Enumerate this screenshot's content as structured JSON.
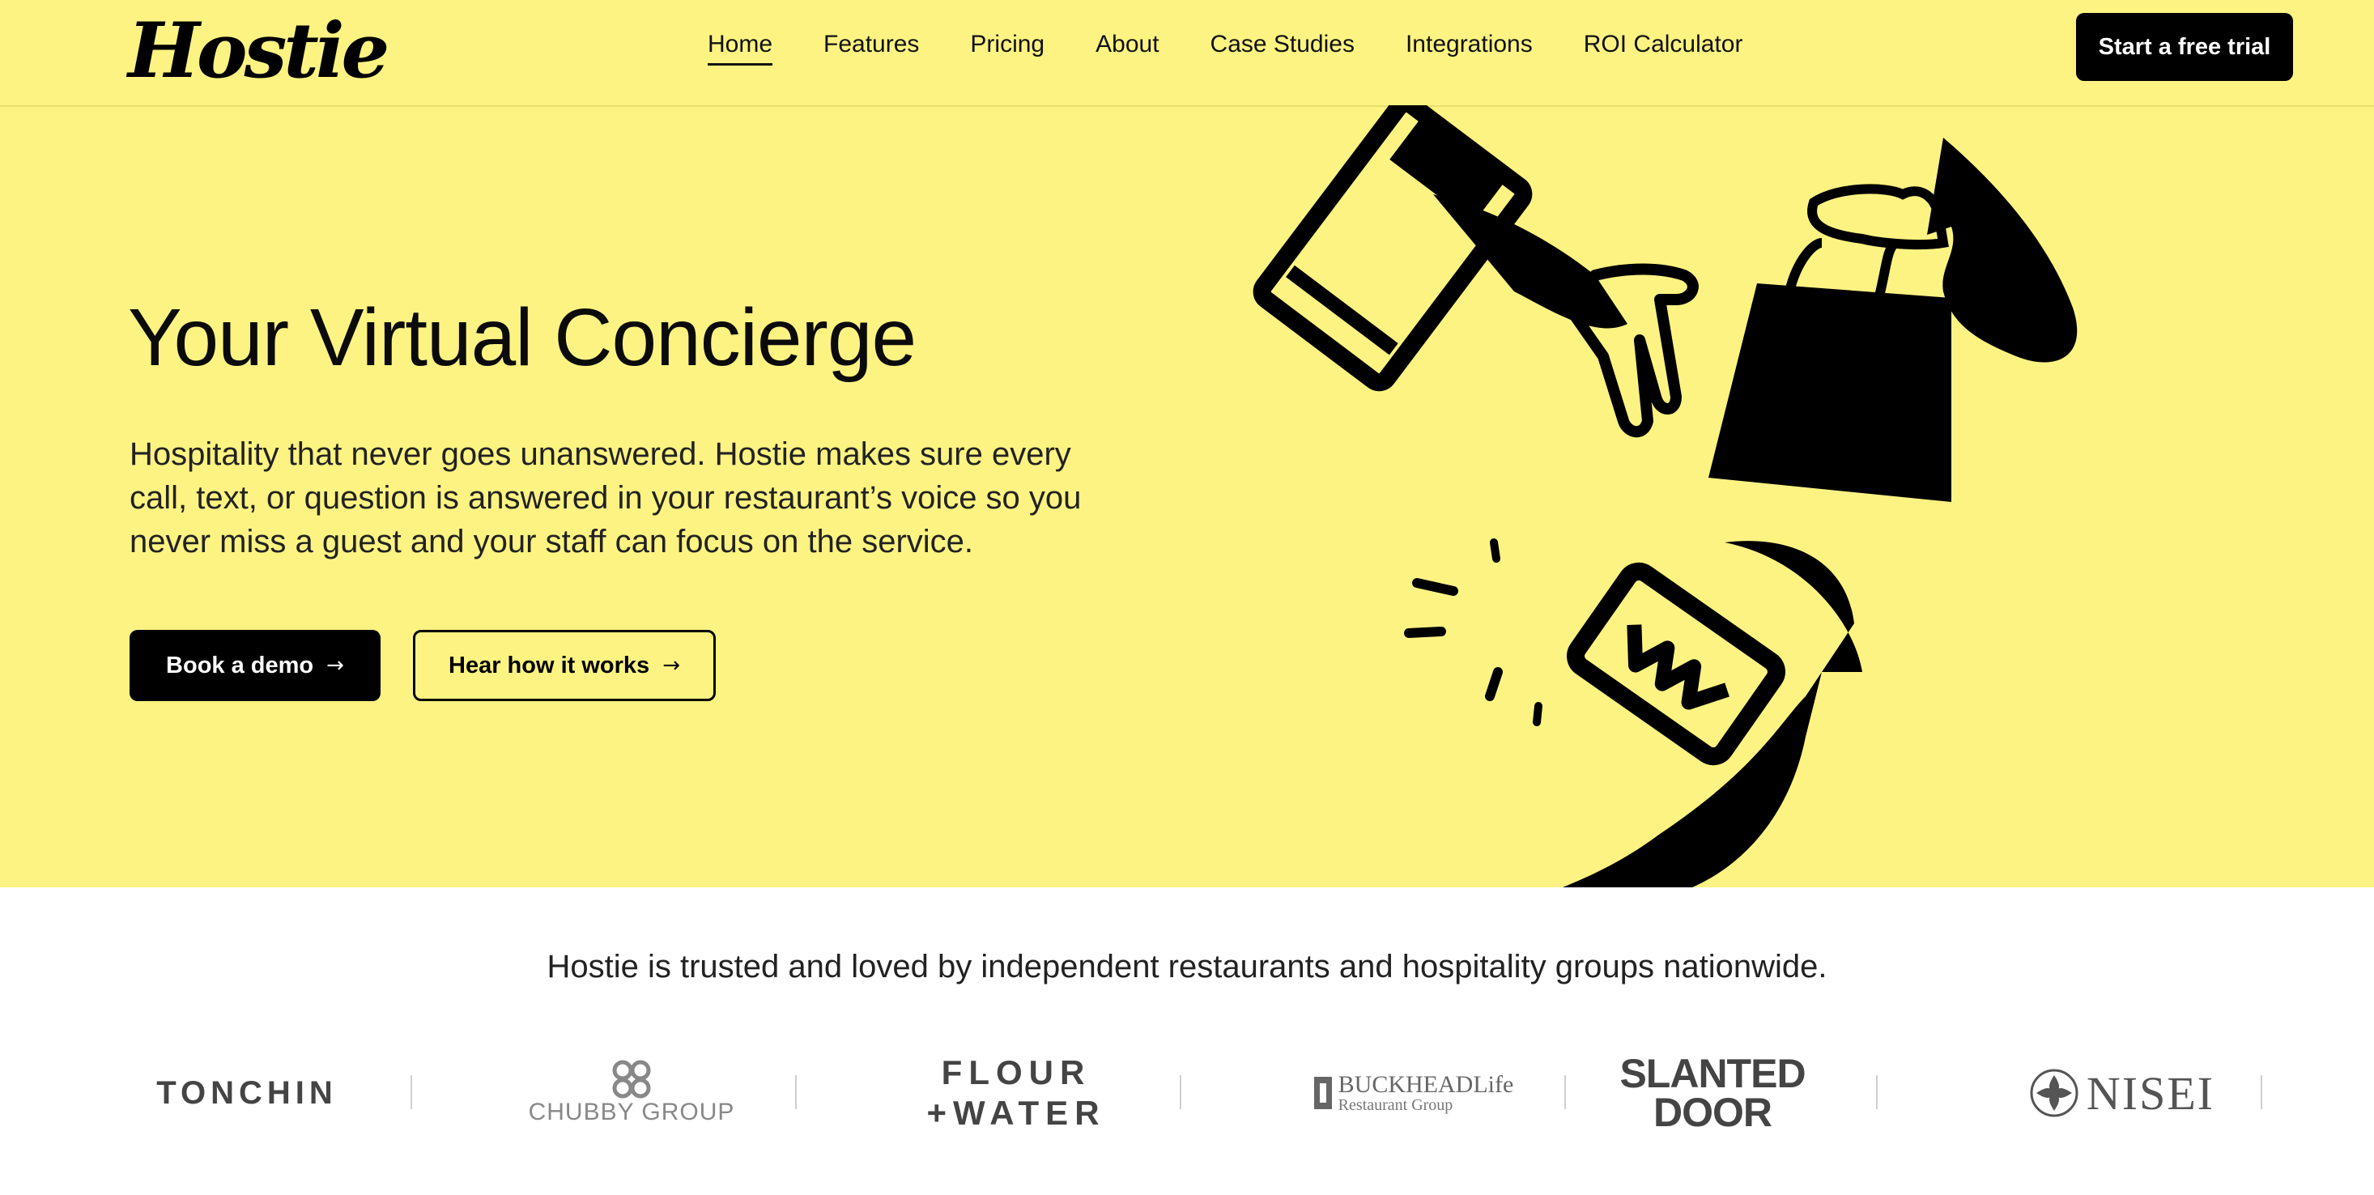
{
  "brand": {
    "logo_text": "Hostie",
    "accent_color": "#fdf382",
    "primary_color": "#000000"
  },
  "nav": {
    "links": [
      {
        "label": "Home",
        "active": true
      },
      {
        "label": "Features"
      },
      {
        "label": "Pricing"
      },
      {
        "label": "About"
      },
      {
        "label": "Case Studies"
      },
      {
        "label": "Integrations"
      },
      {
        "label": "ROI Calculator"
      }
    ],
    "cta_label": "Start a free trial"
  },
  "hero": {
    "title": "Your Virtual Concierge",
    "description": "Hospitality that never goes unanswered. Hostie makes sure every call, text, or question is answered in your restaurant’s voice so you never miss a guest and your staff can focus on the service.",
    "primary_button": "Book a demo",
    "secondary_button": "Hear how it works",
    "arrow_glyph": "→",
    "illustration_icons": [
      "glass-pouring-hand-icon",
      "shopping-bag-hand-icon",
      "phone-ringing-hand-icon"
    ]
  },
  "trust": {
    "text": "Hostie is trusted and loved by independent restaurants and hospitality groups nationwide.",
    "logos": {
      "tonchin": "TONCHIN",
      "chubby": "CHUBBY GROUP",
      "flour_line1": "FLOUR",
      "flour_line2": "+WATER",
      "buckhead_main": "BUCKHEADLife",
      "buckhead_sub": "Restaurant Group",
      "slanted_line1": "SLANTED",
      "slanted_line2": "DOOR",
      "nisei": "NISEI"
    }
  }
}
